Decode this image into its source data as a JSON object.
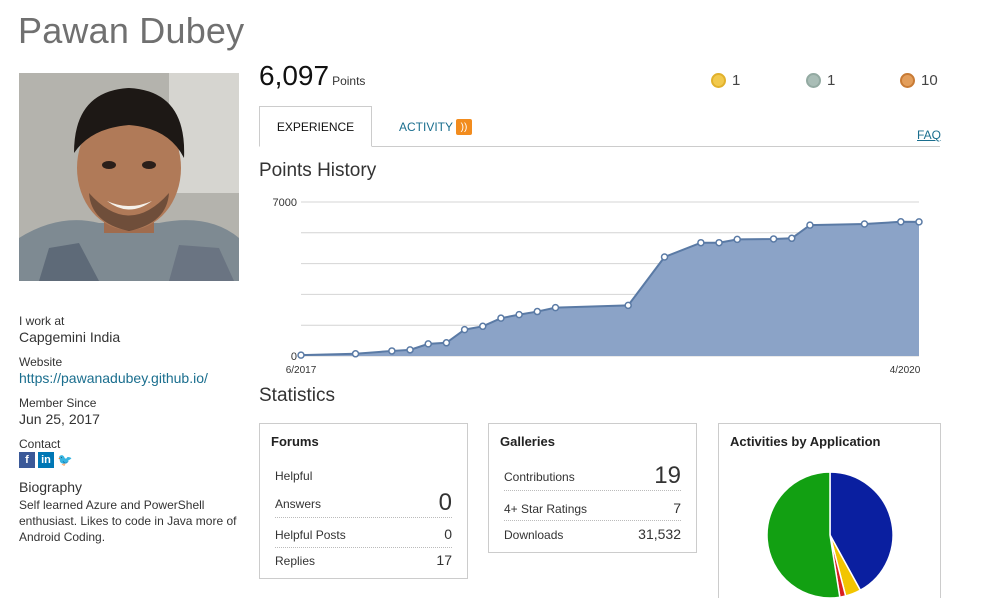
{
  "profile": {
    "name": "Pawan Dubey",
    "work_label": "I work at",
    "work_value": "Capgemini India",
    "website_label": "Website",
    "website_value": "https://pawanadubey.github.io/",
    "member_label": "Member Since",
    "member_value": "Jun 25, 2017",
    "contact_label": "Contact",
    "social": [
      {
        "icon": "facebook-icon",
        "glyph": "f"
      },
      {
        "icon": "linkedin-icon",
        "glyph": "in"
      },
      {
        "icon": "twitter-icon",
        "glyph": "🐦"
      }
    ],
    "bio_label": "Biography",
    "bio_value": "Self learned Azure and PowerShell enthusiast. Likes to code in Java more of Android Coding."
  },
  "summary": {
    "points": "6,097",
    "points_unit": "Points",
    "medals": [
      {
        "type": "gold",
        "count": "1",
        "color": "#f2c94c"
      },
      {
        "type": "silver",
        "count": "1",
        "color": "#a9bdb6"
      },
      {
        "type": "bronze",
        "count": "10",
        "color": "#e39e5b"
      }
    ]
  },
  "tabs": {
    "experience": "EXPERIENCE",
    "activity": "ACTIVITY",
    "faq": "FAQ"
  },
  "sections": {
    "points_history": "Points History",
    "statistics": "Statistics"
  },
  "chart_data": {
    "type": "area",
    "title": "Points History",
    "x_tick_labels": [
      "6/2017",
      "4/2020"
    ],
    "y_tick_labels": [
      "0",
      "7000"
    ],
    "ylim": [
      0,
      7000
    ],
    "grid": true,
    "color": "#8ba3c7",
    "line_color": "#5a7aa5",
    "x": [
      "6/2017",
      "9/2017",
      "11/2017",
      "12/2017",
      "1/2018",
      "2/2018",
      "3/2018",
      "4/2018",
      "5/2018",
      "6/2018",
      "7/2018",
      "8/2018",
      "12/2018",
      "2/2019",
      "4/2019",
      "5/2019",
      "6/2019",
      "8/2019",
      "9/2019",
      "10/2019",
      "1/2020",
      "3/2020",
      "4/2020"
    ],
    "values": [
      40,
      100,
      230,
      280,
      550,
      600,
      1200,
      1350,
      1720,
      1880,
      2020,
      2200,
      2300,
      4500,
      5150,
      5150,
      5300,
      5320,
      5350,
      5950,
      6000,
      6100,
      6097
    ]
  },
  "forums": {
    "title": "Forums",
    "rows": [
      {
        "label": "Helpful",
        "value": ""
      },
      {
        "label": "Answers",
        "value": "0"
      },
      {
        "label": "Helpful Posts",
        "value": "0"
      },
      {
        "label": "Replies",
        "value": "17"
      }
    ]
  },
  "galleries": {
    "title": "Galleries",
    "rows": [
      {
        "label": "Contributions",
        "value": "19"
      },
      {
        "label": "4+ Star Ratings",
        "value": "7"
      },
      {
        "label": "Downloads",
        "value": "31,532"
      }
    ]
  },
  "activities": {
    "title": "Activities by Application",
    "pie": [
      {
        "color": "#0a1fa0",
        "value": 42
      },
      {
        "color": "#f2c500",
        "value": 4
      },
      {
        "color": "#d92020",
        "value": 1.5
      },
      {
        "color": "#12a012",
        "value": 52.5
      }
    ]
  }
}
